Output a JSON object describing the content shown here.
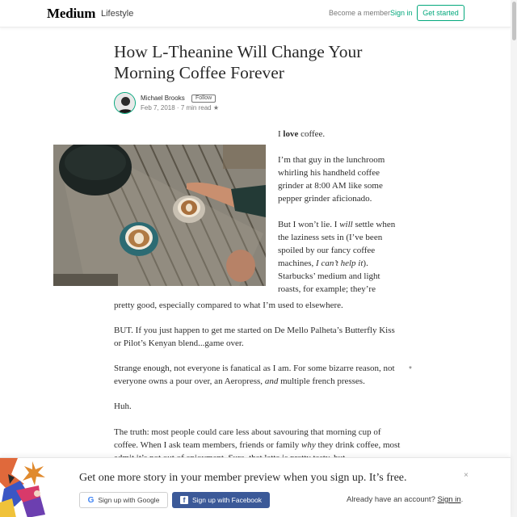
{
  "header": {
    "logo": "Medium",
    "publication": "Lifestyle",
    "become_member": "Become a member",
    "sign_in": "Sign in",
    "get_started": "Get started"
  },
  "article": {
    "title": "How L-Theanine Will Change Your Morning Coffee Forever",
    "author": "Michael Brooks",
    "follow_label": "Follow",
    "date": "Feb 7, 2018",
    "read_time": "7 min read",
    "star": "★",
    "paragraphs": {
      "p1_a": "I ",
      "p1_b": "love",
      "p1_c": " coffee.",
      "p2": "I’m that guy in the lunchroom whirling his handheld coffee grinder at 8:00 AM like some pepper grinder aficionado.",
      "p3_a": "But I won’t lie. I ",
      "p3_b": "will",
      "p3_c": " settle when the laziness sets in (I’ve been spoiled by our fancy coffee machines, ",
      "p3_d": "I can’t help it",
      "p3_e": "). Starbucks’ medium and light roasts, for example; they’re",
      "p3_f": "pretty good, especially compared to what I’m used to elsewhere.",
      "p4": "BUT. If you just happen to get me started on De Mello Palheta’s Butterfly Kiss or Pilot’s Kenyan blend...game over.",
      "p5_a": "Strange enough, not everyone is fanatical as I am. For some bizarre reason, not everyone owns a pour over, an Aeropress, ",
      "p5_b": "and",
      "p5_c": " multiple french presses.",
      "p6": "Huh.",
      "p7_a": "The truth: most people could care less about savouring that morning cup of coffee. When I ask team members, friends or family ",
      "p7_b": "why",
      "p7_c": " they drink coffee, most admit it’s not out of enjoyment. Sure, that latte is pretty tasty, but"
    },
    "side_star": "*"
  },
  "banner": {
    "text": "Get one more story in your member preview when you sign up. It’s free.",
    "close": "×",
    "google": "Sign up with Google",
    "facebook": "Sign up with Facebook",
    "already": "Already have an account?",
    "sign_in": "Sign in",
    "period": "."
  },
  "colors": {
    "accent": "#03a87c",
    "facebook": "#3b5998"
  },
  "icons": [
    "google-icon",
    "facebook-icon",
    "close-icon"
  ]
}
